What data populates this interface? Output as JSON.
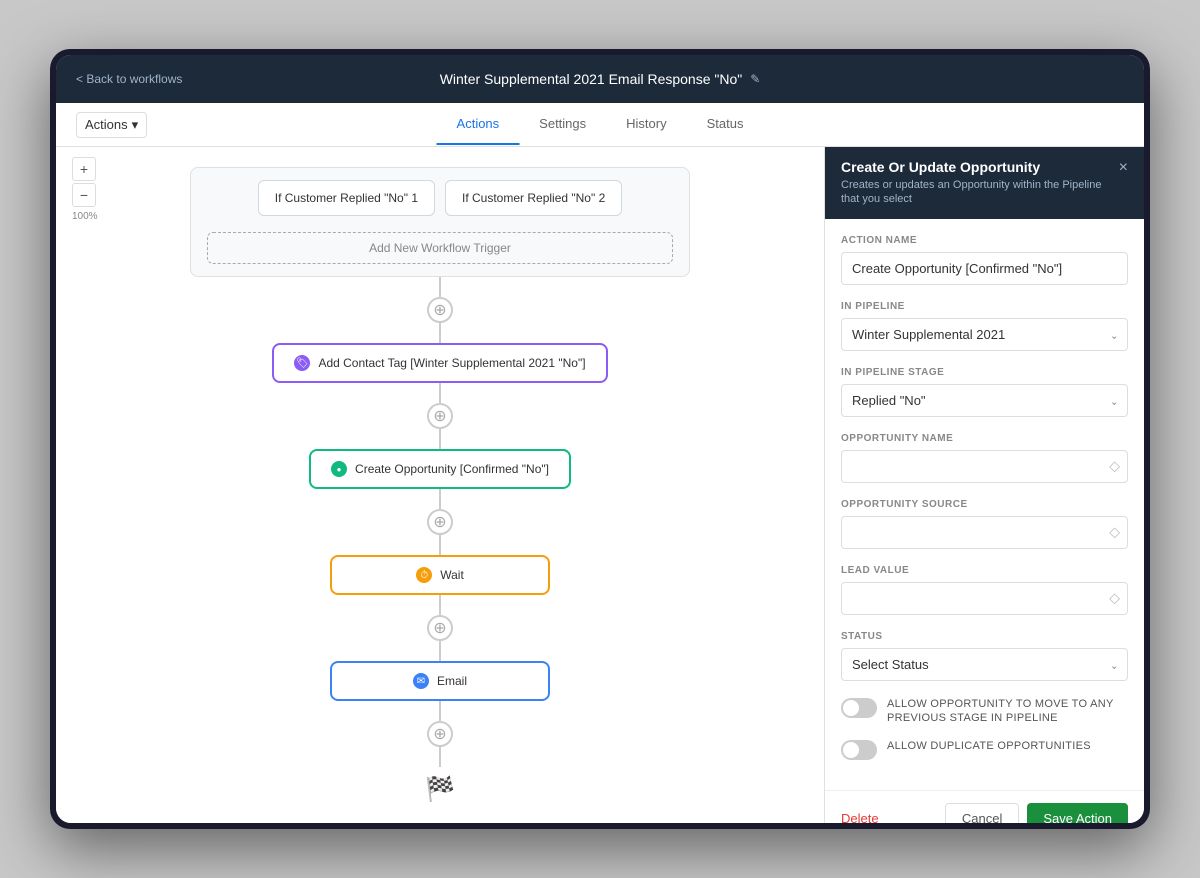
{
  "app": {
    "back_label": "< Back to workflows",
    "title": "Winter Supplemental 2021 Email Response \"No\"",
    "edit_icon": "✎"
  },
  "tabs": [
    {
      "label": "Actions",
      "active": true
    },
    {
      "label": "Settings",
      "active": false
    },
    {
      "label": "History",
      "active": false
    },
    {
      "label": "Status",
      "active": false
    }
  ],
  "toolbar": {
    "actions_label": "Actions",
    "dropdown_icon": "▾"
  },
  "zoom": {
    "plus": "+",
    "minus": "−",
    "level": "100%"
  },
  "workflow": {
    "triggers": [
      {
        "label": "If Customer Replied \"No\" 1"
      },
      {
        "label": "If Customer Replied \"No\" 2"
      }
    ],
    "add_trigger": "Add New Workflow Trigger",
    "nodes": [
      {
        "id": "tag",
        "type": "tag",
        "icon_type": "purple",
        "icon_char": "🏷",
        "label": "Add Contact Tag [Winter Supplemental 2021 \"No\"]"
      },
      {
        "id": "opportunity",
        "type": "opportunity",
        "icon_type": "green",
        "icon_char": "●",
        "label": "Create Opportunity [Confirmed \"No\"]"
      },
      {
        "id": "wait",
        "type": "wait",
        "icon_type": "orange",
        "icon_char": "⏱",
        "label": "Wait"
      },
      {
        "id": "email",
        "type": "email",
        "icon_type": "blue",
        "icon_char": "✉",
        "label": "Email"
      }
    ],
    "connector_add": "+"
  },
  "panel": {
    "title": "Create Or Update Opportunity",
    "subtitle": "Creates or updates an Opportunity within the Pipeline that you select",
    "close_icon": "×",
    "fields": {
      "action_name": {
        "label": "ACTION NAME",
        "value": "Create Opportunity [Confirmed \"No\"]"
      },
      "in_pipeline": {
        "label": "IN PIPELINE",
        "value": "Winter Supplemental 2021",
        "options": [
          "Winter Supplemental 2021"
        ]
      },
      "in_pipeline_stage": {
        "label": "IN PIPELINE STAGE",
        "value": "Replied \"No\"",
        "options": [
          "Replied \"No\""
        ]
      },
      "opportunity_name": {
        "label": "OPPORTUNITY NAME",
        "value": "",
        "icon": "◇"
      },
      "opportunity_source": {
        "label": "OPPORTUNITY SOURCE",
        "value": "",
        "icon": "◇"
      },
      "lead_value": {
        "label": "LEAD VALUE",
        "value": "",
        "icon": "◇"
      },
      "status": {
        "label": "STATUS",
        "placeholder": "Select Status",
        "options": [
          "Select Status"
        ]
      }
    },
    "toggles": [
      {
        "id": "allow-move",
        "label": "ALLOW OPPORTUNITY TO MOVE TO ANY PREVIOUS STAGE IN PIPELINE",
        "enabled": false
      },
      {
        "id": "allow-duplicate",
        "label": "ALLOW DUPLICATE OPPORTUNITIES",
        "enabled": false
      }
    ],
    "footer": {
      "delete_label": "Delete",
      "cancel_label": "Cancel",
      "save_label": "Save Action"
    }
  }
}
